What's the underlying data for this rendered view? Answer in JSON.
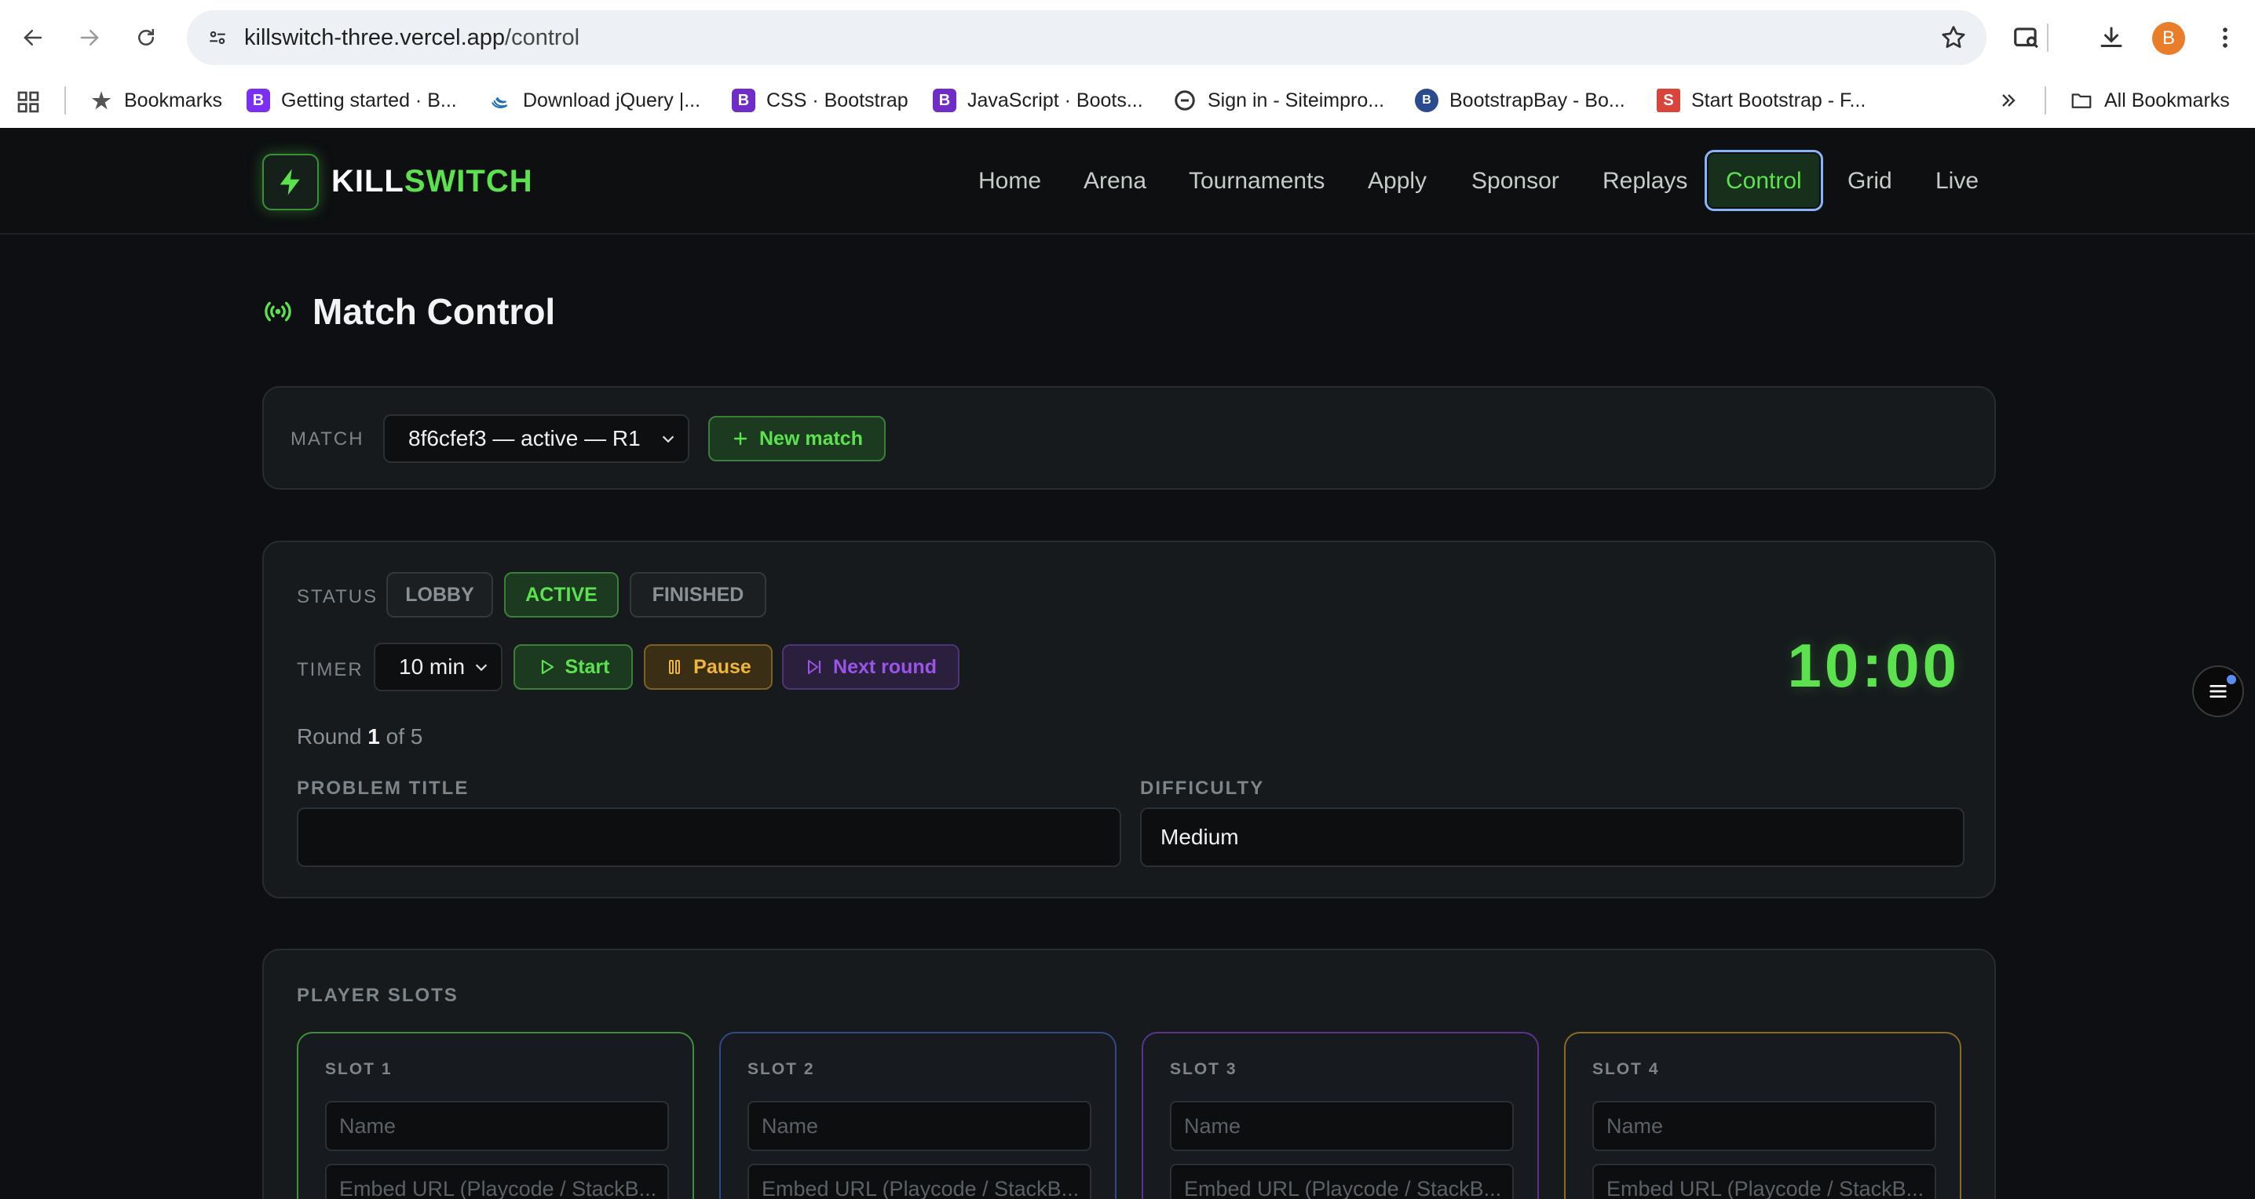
{
  "browser": {
    "url_host": "killswitch-three.vercel.app",
    "url_path": "/control",
    "avatar_letter": "B",
    "bookmarks": [
      {
        "label": "Bookmarks",
        "icon": "star-icon"
      },
      {
        "label": "Getting started · B...",
        "icon": "bootstrap-icon",
        "badge": "B",
        "color": "#7b2ff2"
      },
      {
        "label": "Download jQuery |...",
        "icon": "jquery-icon",
        "color": "#1d6fb8"
      },
      {
        "label": "CSS · Bootstrap",
        "icon": "bootstrap-icon",
        "badge": "B",
        "color": "#6f2cc6"
      },
      {
        "label": "JavaScript · Boots...",
        "icon": "bootstrap-icon",
        "badge": "B",
        "color": "#6f2cc6"
      },
      {
        "label": "Sign in - Siteimpro...",
        "icon": "siteimprove-icon",
        "color": "#333333"
      },
      {
        "label": "BootstrapBay - Bo...",
        "icon": "bootstrapbay-icon",
        "badge": "B",
        "color": "#2a4b8d"
      },
      {
        "label": "Start Bootstrap - F...",
        "icon": "startbootstrap-icon",
        "badge": "S",
        "color": "#d9453b"
      }
    ],
    "all_bookmarks_label": "All Bookmarks"
  },
  "site": {
    "logo_part1": "KILL",
    "logo_part2": "SWITCH",
    "nav": [
      {
        "label": "Home",
        "active": false
      },
      {
        "label": "Arena",
        "active": false
      },
      {
        "label": "Tournaments",
        "active": false
      },
      {
        "label": "Apply",
        "active": false
      },
      {
        "label": "Sponsor",
        "active": false
      },
      {
        "label": "Replays",
        "active": false
      },
      {
        "label": "Control",
        "active": true
      },
      {
        "label": "Grid",
        "active": false
      },
      {
        "label": "Live",
        "active": false
      }
    ]
  },
  "page": {
    "title": "Match Control"
  },
  "match_card": {
    "label": "MATCH",
    "selected_match": "8f6cfef3 — active — R1",
    "new_match_label": "New match"
  },
  "status_card": {
    "status_label": "STATUS",
    "statuses": [
      {
        "label": "LOBBY",
        "active": false
      },
      {
        "label": "ACTIVE",
        "active": true
      },
      {
        "label": "FINISHED",
        "active": false
      }
    ],
    "timer_label": "TIMER",
    "timer_selected": "10 min",
    "start_label": "Start",
    "pause_label": "Pause",
    "next_round_label": "Next round",
    "countdown": "10:00",
    "round_prefix": "Round",
    "round_current": "1",
    "round_suffix": "of 5",
    "problem_title_label": "PROBLEM TITLE",
    "problem_title_value": "",
    "difficulty_label": "DIFFICULTY",
    "difficulty_value": "Medium"
  },
  "slots_card": {
    "label": "PLAYER SLOTS",
    "slots": [
      {
        "label": "SLOT 1",
        "name_placeholder": "Name",
        "embed_placeholder": "Embed URL (Playcode / StackB...",
        "color": "#3d8f3a"
      },
      {
        "label": "SLOT 2",
        "name_placeholder": "Name",
        "embed_placeholder": "Embed URL (Playcode / StackB...",
        "color": "#2f4a86"
      },
      {
        "label": "SLOT 3",
        "name_placeholder": "Name",
        "embed_placeholder": "Embed URL (Playcode / StackB...",
        "color": "#5a3290"
      },
      {
        "label": "SLOT 4",
        "name_placeholder": "Name",
        "embed_placeholder": "Embed URL (Playcode / StackB...",
        "color": "#8a6a22"
      }
    ]
  }
}
